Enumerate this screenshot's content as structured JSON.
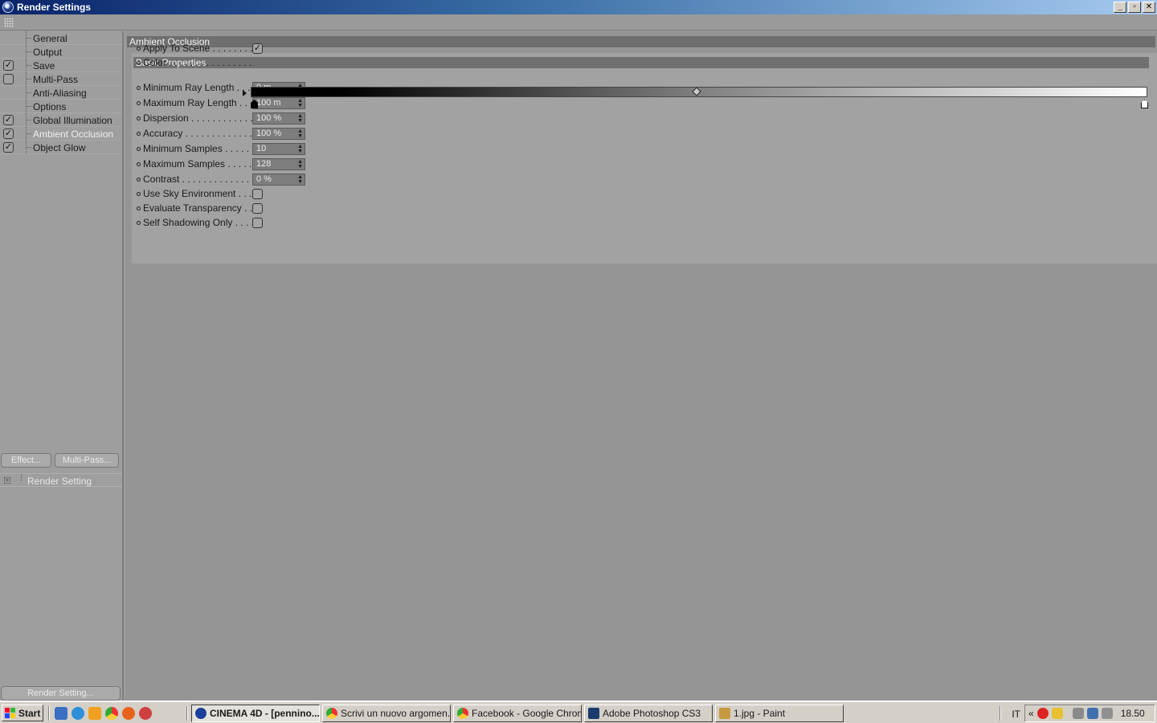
{
  "window": {
    "title": "Render Settings",
    "minimize": "_",
    "maximize": "▫",
    "close": "✕"
  },
  "sidebar": {
    "items": [
      {
        "label": "General",
        "has_checkbox": false,
        "checked": false
      },
      {
        "label": "Output",
        "has_checkbox": false,
        "checked": false
      },
      {
        "label": "Save",
        "has_checkbox": true,
        "checked": true
      },
      {
        "label": "Multi-Pass",
        "has_checkbox": true,
        "checked": false
      },
      {
        "label": "Anti-Aliasing",
        "has_checkbox": false,
        "checked": false
      },
      {
        "label": "Options",
        "has_checkbox": false,
        "checked": false
      },
      {
        "label": "Global Illumination",
        "has_checkbox": true,
        "checked": true
      },
      {
        "label": "Ambient Occlusion",
        "has_checkbox": true,
        "checked": true
      },
      {
        "label": "Object Glow",
        "has_checkbox": true,
        "checked": true
      }
    ],
    "effect_button": "Effect...",
    "multipass_button": "Multi-Pass...",
    "render_list_item": "Render Setting",
    "render_setting_button": "Render Setting..."
  },
  "main": {
    "section_title": "Ambient Occlusion",
    "group_title": "Basic Properties",
    "properties": [
      {
        "label": "Apply To Scene",
        "type": "checkbox",
        "checked": true
      },
      {
        "label": "Color",
        "type": "gradient"
      },
      {
        "label": "Minimum Ray Length",
        "type": "number",
        "value": "0 m"
      },
      {
        "label": "Maximum Ray Length",
        "type": "number",
        "value": "100 m"
      },
      {
        "label": "Dispersion",
        "type": "number",
        "value": "100 %"
      },
      {
        "label": "Accuracy",
        "type": "number",
        "value": "100 %"
      },
      {
        "label": "Minimum Samples",
        "type": "number",
        "value": "10"
      },
      {
        "label": "Maximum Samples",
        "type": "number",
        "value": "128"
      },
      {
        "label": "Contrast",
        "type": "number",
        "value": "0 %"
      },
      {
        "label": "Use Sky Environment",
        "type": "checkbox",
        "checked": false
      },
      {
        "label": "Evaluate Transparency",
        "type": "checkbox",
        "checked": false
      },
      {
        "label": "Self Shadowing Only",
        "type": "checkbox",
        "checked": false
      }
    ],
    "gradient": {
      "start_color": "#000000",
      "end_color": "#ffffff"
    }
  },
  "taskbar": {
    "start_label": "Start",
    "tasks": [
      {
        "label": "CINEMA 4D - [pennino...",
        "icon": "cinema4d-icon",
        "active": true
      },
      {
        "label": "Scrivi un nuovo argomen...",
        "icon": "chrome-icon",
        "active": false
      },
      {
        "label": "Facebook - Google Chrome",
        "icon": "chrome-icon",
        "active": false
      },
      {
        "label": "Adobe Photoshop CS3",
        "icon": "photoshop-icon",
        "active": false
      },
      {
        "label": "1.jpg - Paint",
        "icon": "paint-icon",
        "active": false
      }
    ],
    "language": "IT",
    "tray_chevron": "«",
    "clock": "18.50"
  }
}
